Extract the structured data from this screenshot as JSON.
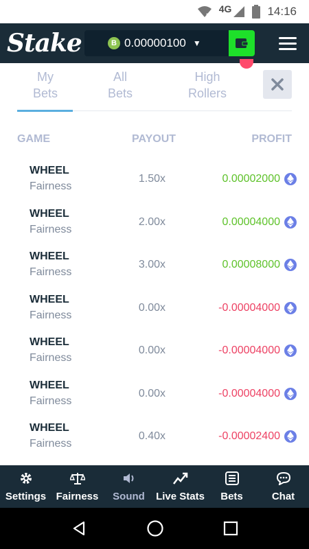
{
  "status_bar": {
    "network": "4G",
    "time": "14:16"
  },
  "header": {
    "logo": "Stake",
    "balance": "0.00000100",
    "currency_symbol": "B"
  },
  "tabs": [
    {
      "line1": "My",
      "line2": "Bets",
      "active": true
    },
    {
      "line1": "All",
      "line2": "Bets",
      "active": false
    },
    {
      "line1": "High",
      "line2": "Rollers",
      "active": false
    }
  ],
  "table": {
    "headers": {
      "game": "GAME",
      "payout": "PAYOUT",
      "profit": "PROFIT"
    },
    "rows": [
      {
        "game": "WHEEL",
        "sub": "Fairness",
        "payout": "1.50x",
        "profit": "0.00002000",
        "positive": true
      },
      {
        "game": "WHEEL",
        "sub": "Fairness",
        "payout": "2.00x",
        "profit": "0.00004000",
        "positive": true
      },
      {
        "game": "WHEEL",
        "sub": "Fairness",
        "payout": "3.00x",
        "profit": "0.00008000",
        "positive": true
      },
      {
        "game": "WHEEL",
        "sub": "Fairness",
        "payout": "0.00x",
        "profit": "-0.00004000",
        "positive": false
      },
      {
        "game": "WHEEL",
        "sub": "Fairness",
        "payout": "0.00x",
        "profit": "-0.00004000",
        "positive": false
      },
      {
        "game": "WHEEL",
        "sub": "Fairness",
        "payout": "0.00x",
        "profit": "-0.00004000",
        "positive": false
      },
      {
        "game": "WHEEL",
        "sub": "Fairness",
        "payout": "0.40x",
        "profit": "-0.00002400",
        "positive": false
      }
    ]
  },
  "bottom_nav": [
    {
      "label": "Settings",
      "icon": "gear-icon",
      "dim": false
    },
    {
      "label": "Fairness",
      "icon": "scale-icon",
      "dim": false
    },
    {
      "label": "Sound",
      "icon": "speaker-icon",
      "dim": true
    },
    {
      "label": "Live Stats",
      "icon": "trend-icon",
      "dim": false
    },
    {
      "label": "Bets",
      "icon": "list-icon",
      "dim": false
    },
    {
      "label": "Chat",
      "icon": "chat-icon",
      "dim": false
    }
  ],
  "colors": {
    "header_bg": "#1a2c38",
    "positive": "#5ec22a",
    "negative": "#ed4163",
    "wallet_button": "#1ee02a",
    "tab_underline": "#5aaedf"
  }
}
